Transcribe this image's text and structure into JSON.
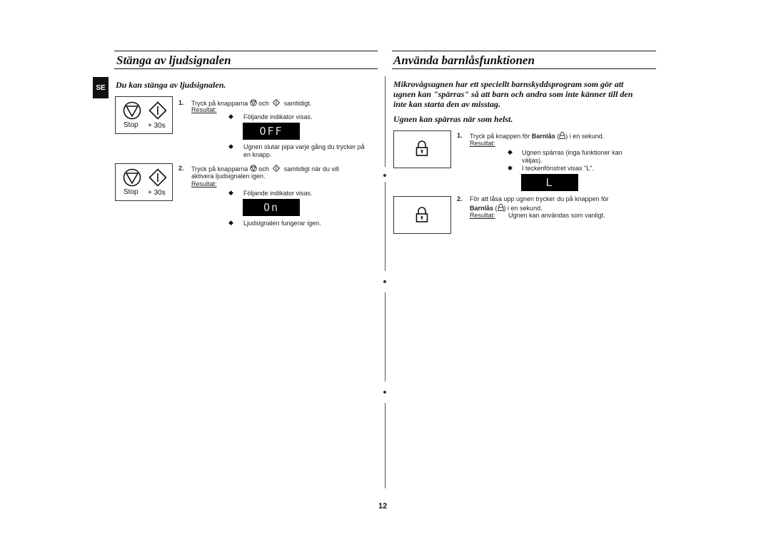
{
  "left": {
    "title": "Stänga av ljudsignalen",
    "lang_tab": "SE",
    "subtitle": "Du kan stänga av ljudsignalen.",
    "panel_buttons": {
      "stop": "Stop",
      "plus30": "+ 30s"
    },
    "steps": [
      {
        "number": "1.",
        "text_before": "Tryck på knapparna",
        "text_mid": "och",
        "text_after": "samtidigt.",
        "result_label": "Resultat:",
        "bullets": [
          "Följande indikator visas.",
          "Ugnen slutar pipa varje gång du trycker på",
          "en knapp."
        ],
        "display": "OFF"
      },
      {
        "number": "2.",
        "text_before": "Tryck på knapparna",
        "text_mid": "och",
        "text_after": "samtidigt när du vill",
        "text_line2": "aktivera ljudsignalen igen.",
        "result_label": "Resultat:",
        "bullets": [
          "Följande indikator visas.",
          "Ljudsignalen fungerar igen."
        ],
        "display": "On"
      }
    ]
  },
  "right": {
    "title": "Använda barnlåsfunktionen",
    "intro": [
      "Mikrovågsugnen har ett speciellt barnskyddsprogram som gör att",
      "ugnen kan \"spärras\" så att barn och andra som inte känner till den",
      "inte kan starta den av misstag."
    ],
    "subtitle": "Ugnen kan spärras när som helst.",
    "steps": [
      {
        "number": "1.",
        "text_before": "Tryck på knappen för",
        "bold": "Barnlås",
        "text_after": ") i en sekund.",
        "result_label": "Resultat:",
        "bullets": [
          "Ugnen spärras (inga funktioner kan",
          "väljas).",
          "I teckenfönstret visas \"L\"."
        ],
        "display": "L"
      },
      {
        "number": "2.",
        "text_line1": "För att låsa upp ugnen trycker du på knappen för",
        "bold": "Barnlås",
        "text_after": ") i en sekund.",
        "result_label": "Resultat:",
        "result_text": "Ugnen kan användas som vanligt."
      }
    ]
  },
  "page_number": "12"
}
